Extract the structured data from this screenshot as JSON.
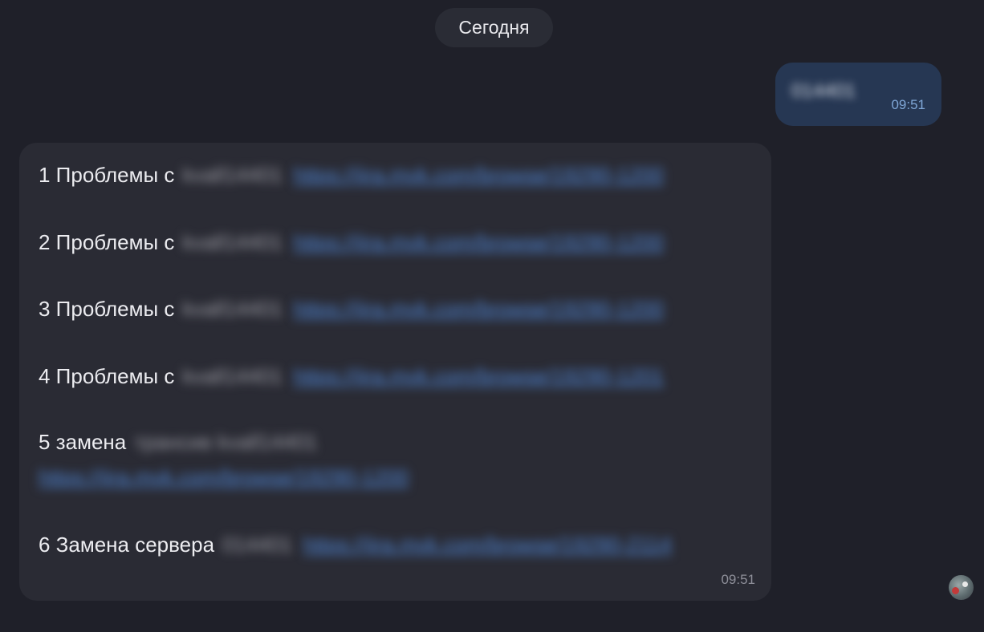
{
  "date_separator": "Сегодня",
  "outgoing_message": {
    "text": "014401",
    "time": "09:51"
  },
  "incoming_message": {
    "time": "09:51",
    "lines": [
      {
        "prefix": "1 Проблемы с",
        "redacted": "kvall14401",
        "link": "https://jira.mvk.com/browse/19290-1200"
      },
      {
        "prefix": "2 Проблемы с",
        "redacted": "kvall14401",
        "link": "https://jira.mvk.com/browse/19290-1200"
      },
      {
        "prefix": "3 Проблемы с",
        "redacted": "kvall14401",
        "link": "https://jira.mvk.com/browse/19290-1200"
      },
      {
        "prefix": "4 Проблемы с",
        "redacted": "kvall14401",
        "link": "https://jira.mvk.com/browse/19290-1201"
      },
      {
        "prefix": "5 замена",
        "redacted": "трансив kvall14401",
        "link": "https://jira.mvk.com/browse/19290-1200"
      },
      {
        "prefix": "6 Замена сервера",
        "redacted": "014401",
        "link": "https://jira.mvk.com/browse/19290-2114"
      }
    ]
  },
  "avatar": {
    "icon": "user-avatar-icon"
  }
}
